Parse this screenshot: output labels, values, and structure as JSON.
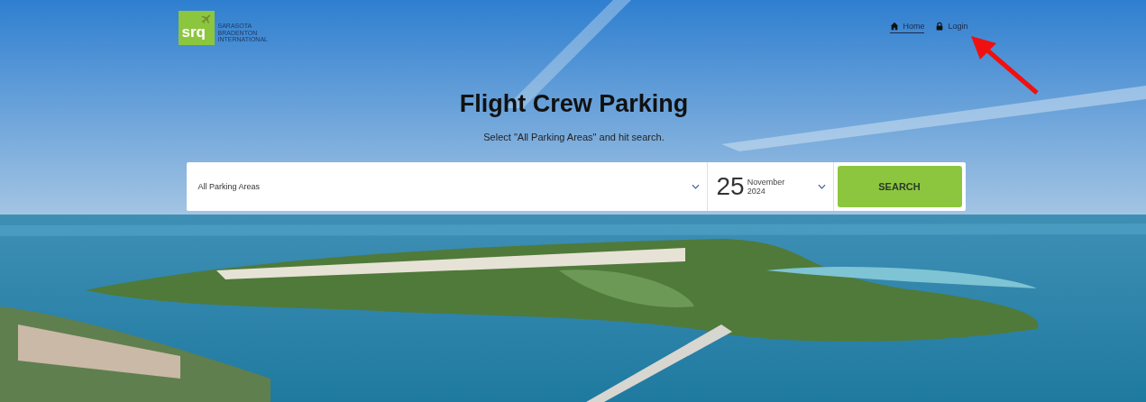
{
  "logo": {
    "mark": "srq",
    "lines": [
      "SARASOTA",
      "BRADENTON",
      "INTERNATIONAL"
    ]
  },
  "nav": [
    {
      "label": "Home",
      "kind": "home",
      "selected": true
    },
    {
      "label": "Login",
      "kind": "lock",
      "selected": false
    }
  ],
  "hero": {
    "title": "Flight Crew Parking",
    "subtitle": "Select \"All Parking Areas\" and hit search."
  },
  "search": {
    "area": "All Parking Areas",
    "day": "25",
    "month": "November",
    "year": "2024",
    "button": "SEARCH"
  }
}
